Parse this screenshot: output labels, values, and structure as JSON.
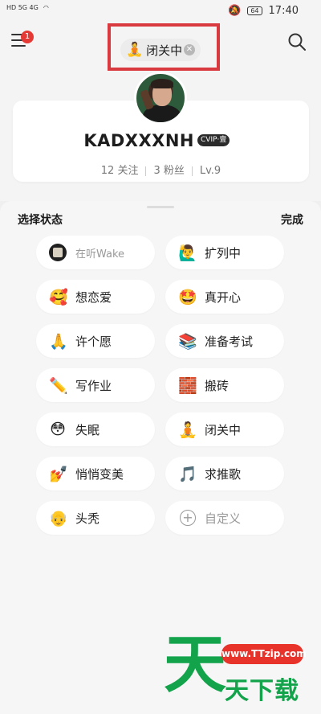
{
  "status_bar": {
    "left_indicators": "HD 5G 4G",
    "battery": "64",
    "time": "17:40"
  },
  "header": {
    "menu_badge": "1",
    "current_status": {
      "emoji": "🧘",
      "label": "闭关中"
    }
  },
  "profile": {
    "username": "KADXXXNH",
    "vip_badge": "CVIP·壹",
    "stats": {
      "follow": "12 关注",
      "fans": "3 粉丝",
      "level": "Lv.9"
    }
  },
  "sheet": {
    "title": "选择状态",
    "done_label": "完成",
    "status_options": [
      {
        "icon": "album-cover-icon",
        "label": "在听Wake",
        "muted": true
      },
      {
        "icon": "🙋‍♂️",
        "label": "扩列中"
      },
      {
        "icon": "🥰",
        "label": "想恋爱"
      },
      {
        "icon": "🤩",
        "label": "真开心"
      },
      {
        "icon": "🙏",
        "label": "许个愿"
      },
      {
        "icon": "📚",
        "label": "准备考试"
      },
      {
        "icon": "✏️",
        "label": "写作业"
      },
      {
        "icon": "🧱",
        "label": "搬砖"
      },
      {
        "icon": "😳",
        "label": "失眠"
      },
      {
        "icon": "🧘",
        "label": "闭关中"
      },
      {
        "icon": "💅",
        "label": "悄悄变美"
      },
      {
        "icon": "🎵",
        "label": "求推歌"
      },
      {
        "icon": "👴",
        "label": "头秃"
      },
      {
        "icon": "plus-icon",
        "label": "自定义"
      }
    ]
  },
  "watermark": {
    "big_char": "天",
    "url": "www.TTzip.com",
    "text": "天下载"
  }
}
